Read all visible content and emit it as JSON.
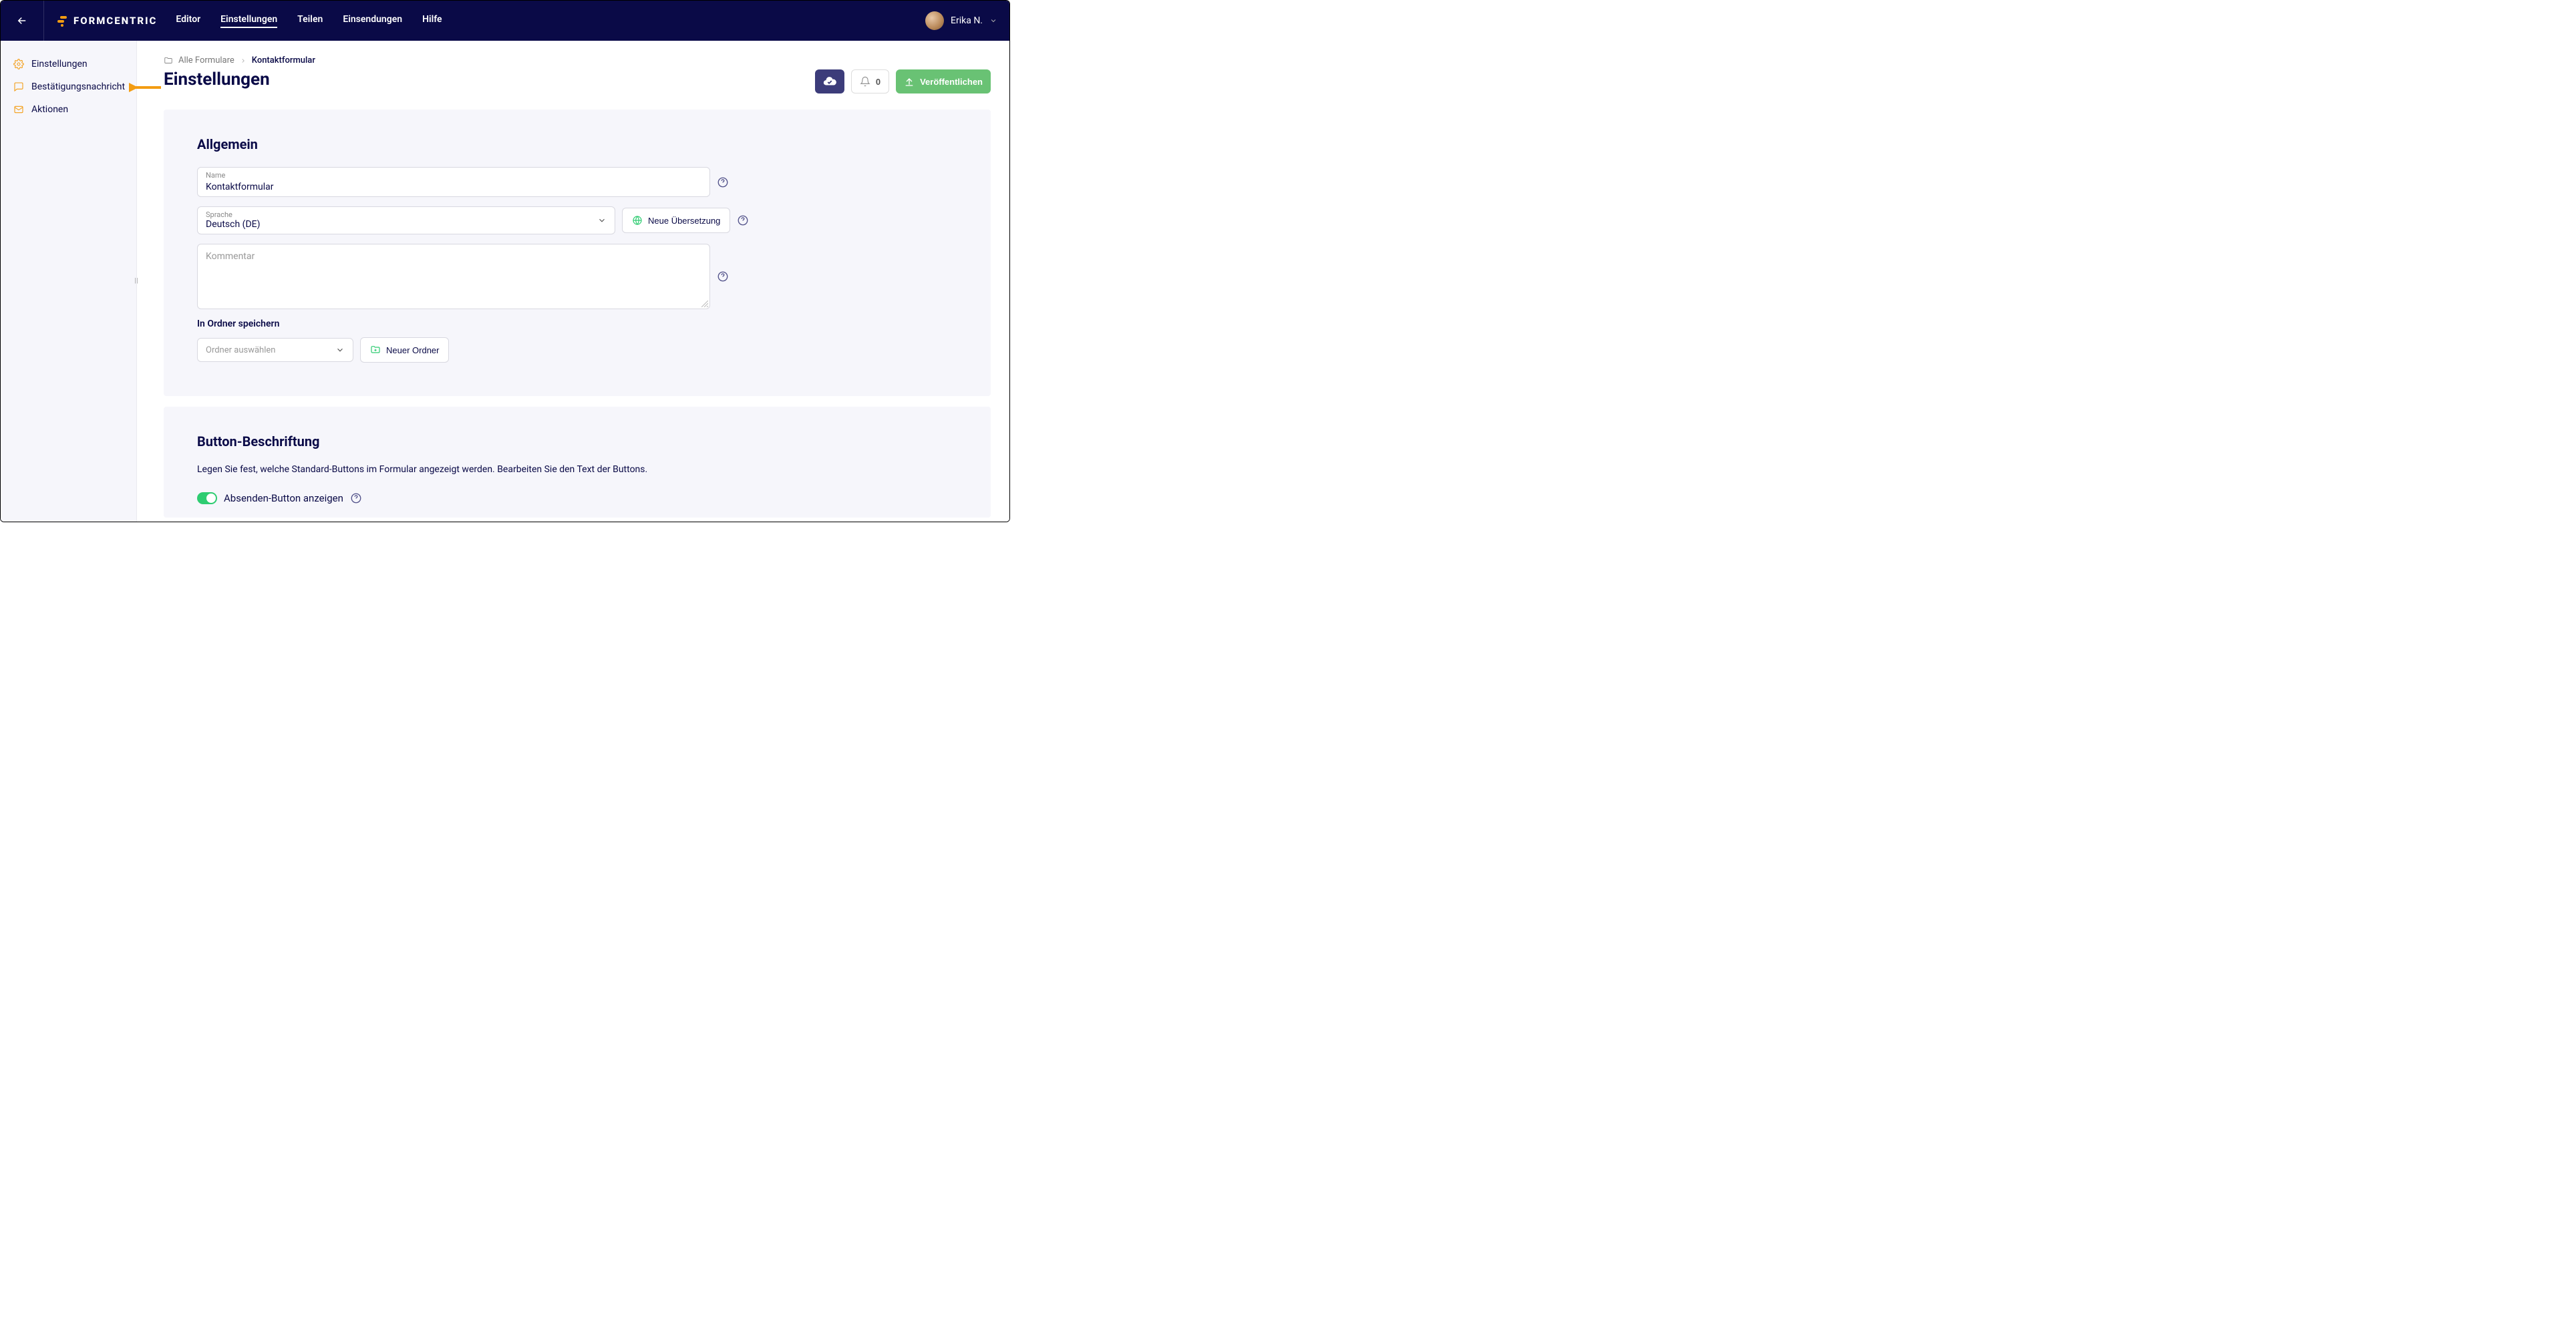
{
  "brand": "FORMCENTRIC",
  "nav": {
    "items": [
      {
        "label": "Editor"
      },
      {
        "label": "Einstellungen"
      },
      {
        "label": "Teilen"
      },
      {
        "label": "Einsendungen"
      },
      {
        "label": "Hilfe"
      }
    ]
  },
  "user": {
    "name": "Erika N."
  },
  "sidebar": {
    "items": [
      {
        "label": "Einstellungen"
      },
      {
        "label": "Bestätigungsnachricht"
      },
      {
        "label": "Aktionen"
      }
    ]
  },
  "breadcrumb": {
    "root": "Alle Formulare",
    "current": "Kontaktformular"
  },
  "page": {
    "title": "Einstellungen"
  },
  "actions": {
    "notifications_count": "0",
    "publish_label": "Veröffentlichen"
  },
  "section_general": {
    "title": "Allgemein",
    "name_label": "Name",
    "name_value": "Kontaktformular",
    "language_label": "Sprache",
    "language_value": "Deutsch (DE)",
    "new_translation": "Neue Übersetzung",
    "comment_placeholder": "Kommentar",
    "folder_label": "In Ordner speichern",
    "folder_placeholder": "Ordner auswählen",
    "new_folder": "Neuer Ordner"
  },
  "section_buttons": {
    "title": "Button-Beschriftung",
    "desc": "Legen Sie fest, welche Standard-Buttons im Formular angezeigt werden. Bearbeiten Sie den Text der Buttons.",
    "toggle_label": "Absenden-Button anzeigen"
  }
}
